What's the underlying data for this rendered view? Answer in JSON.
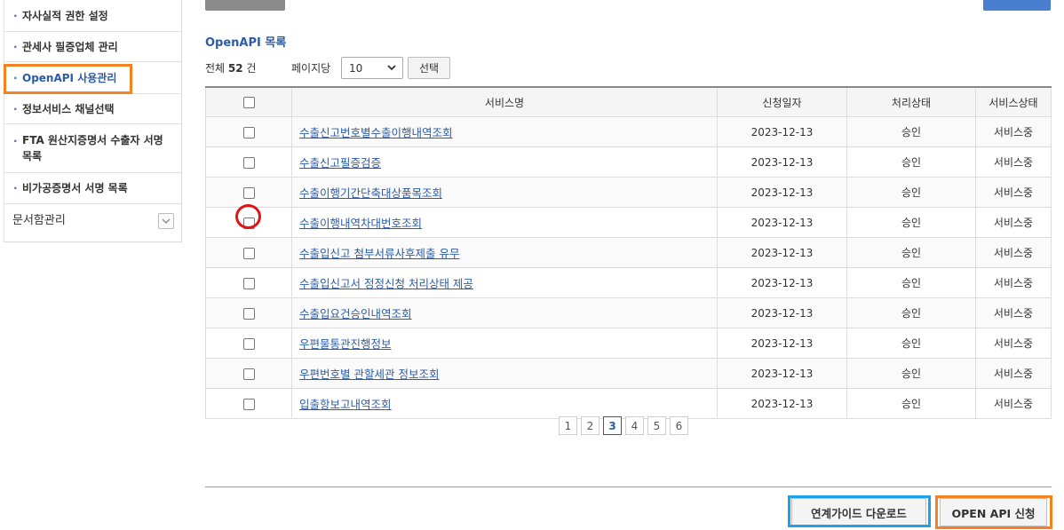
{
  "sidebar": {
    "items": [
      {
        "label": "자사실적 권한 설정"
      },
      {
        "label": "관세사 필증업체 관리"
      },
      {
        "label": "OpenAPI 사용관리"
      },
      {
        "label": "정보서비스 채널선택"
      },
      {
        "label": "FTA 원산지증명서 수출자 서명 목록"
      },
      {
        "label": "비가공증명서 서명 목록"
      }
    ],
    "bullet": "·",
    "doc_menu": {
      "label": "문서함관리",
      "icon": "chevron-down-icon"
    }
  },
  "main": {
    "section_title": "OpenAPI 목록",
    "total_prefix": "전체 ",
    "total_count": "52",
    "total_suffix": " 건",
    "per_page_label": "페이지당",
    "per_page_value": "10",
    "select_button": "선택"
  },
  "table": {
    "headers": [
      "서비스명",
      "신청일자",
      "처리상태",
      "서비스상태"
    ],
    "rows": [
      {
        "service": "수출신고번호별수출이행내역조회",
        "date": "2023-12-13",
        "process": "승인",
        "status": "서비스중"
      },
      {
        "service": "수출신고필증검증",
        "date": "2023-12-13",
        "process": "승인",
        "status": "서비스중"
      },
      {
        "service": "수출이행기간단축대상품목조회",
        "date": "2023-12-13",
        "process": "승인",
        "status": "서비스중"
      },
      {
        "service": "수출이행내역차대번호조회",
        "date": "2023-12-13",
        "process": "승인",
        "status": "서비스중"
      },
      {
        "service": "수출입신고 첨부서류사후제출 유무",
        "date": "2023-12-13",
        "process": "승인",
        "status": "서비스중"
      },
      {
        "service": "수출입신고서 정정신청 처리상태 제공",
        "date": "2023-12-13",
        "process": "승인",
        "status": "서비스중"
      },
      {
        "service": "수출입요건승인내역조회",
        "date": "2023-12-13",
        "process": "승인",
        "status": "서비스중"
      },
      {
        "service": "우편물통관진행정보",
        "date": "2023-12-13",
        "process": "승인",
        "status": "서비스중"
      },
      {
        "service": "우편번호별 관할세관 정보조회",
        "date": "2023-12-13",
        "process": "승인",
        "status": "서비스중"
      },
      {
        "service": "입출항보고내역조회",
        "date": "2023-12-13",
        "process": "승인",
        "status": "서비스중"
      }
    ]
  },
  "pagination": {
    "pages": [
      "1",
      "2",
      "3",
      "4",
      "5",
      "6"
    ],
    "current_page": 3
  },
  "buttons": {
    "guide_download": "연계가이드 다운로드",
    "open_api_apply": "OPEN API 신청"
  },
  "colors": {
    "accent_blue": "#2b5ca8",
    "highlight_orange": "#f58220",
    "highlight_blue": "#1ea1e6",
    "highlight_red": "#e01414"
  }
}
